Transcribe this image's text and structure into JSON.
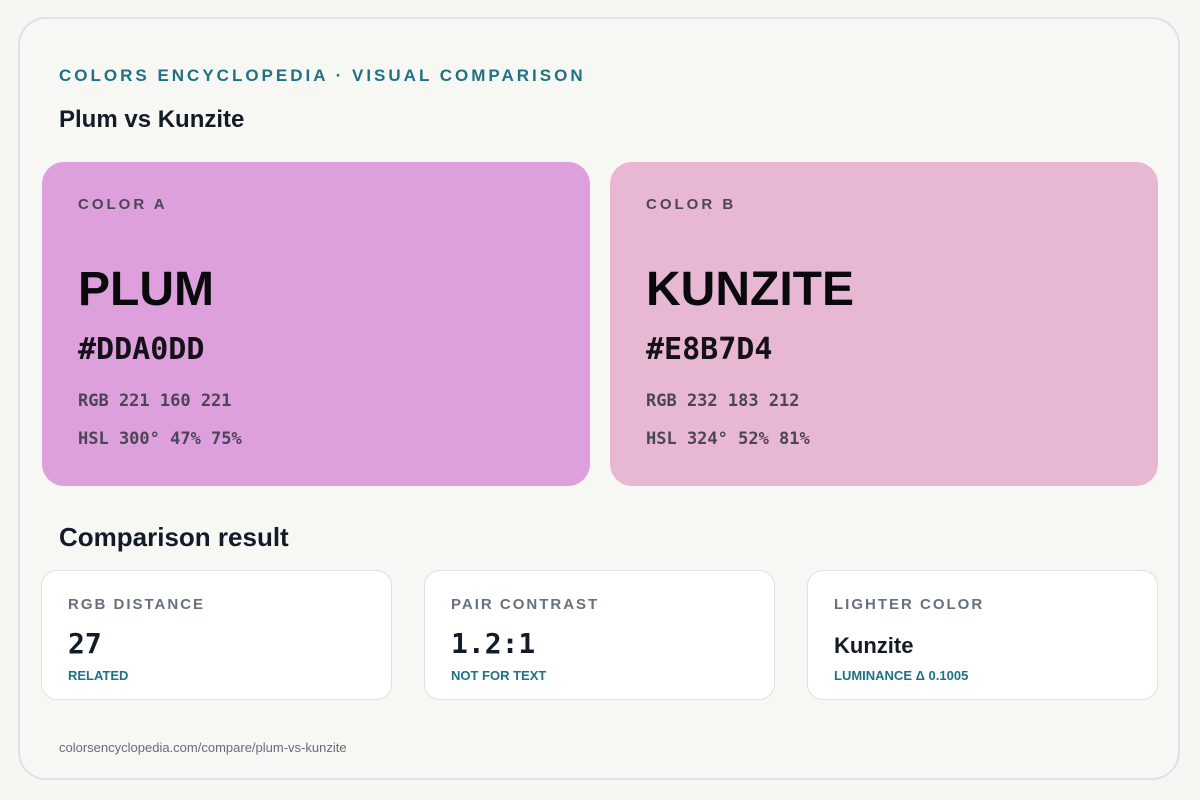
{
  "header": {
    "eyebrow": "COLORS ENCYCLOPEDIA · VISUAL COMPARISON",
    "title": "Plum vs Kunzite"
  },
  "colors": [
    {
      "slot_label": "COLOR A",
      "name": "PLUM",
      "hex": "#DDA0DD",
      "rgb": "RGB 221 160 221",
      "hsl": "HSL 300° 47% 75%",
      "swatch_color": "#DDA0DD"
    },
    {
      "slot_label": "COLOR B",
      "name": "KUNZITE",
      "hex": "#E8B7D4",
      "rgb": "RGB 232 183 212",
      "hsl": "HSL 324° 52% 81%",
      "swatch_color": "#E8B7D4"
    }
  ],
  "comparison": {
    "title": "Comparison result",
    "cards": [
      {
        "label": "RGB DISTANCE",
        "value": "27",
        "note": "RELATED"
      },
      {
        "label": "PAIR CONTRAST",
        "value": "1.2:1",
        "note": "NOT FOR TEXT"
      },
      {
        "label": "LIGHTER COLOR",
        "value": "Kunzite",
        "note": "LUMINANCE Δ 0.1005"
      }
    ]
  },
  "footer": {
    "url": "colorsencyclopedia.com/compare/plum-vs-kunzite"
  },
  "theme": {
    "accent": "#1F7284",
    "background": "#F7F7F3",
    "card": "#FFFFFF"
  }
}
